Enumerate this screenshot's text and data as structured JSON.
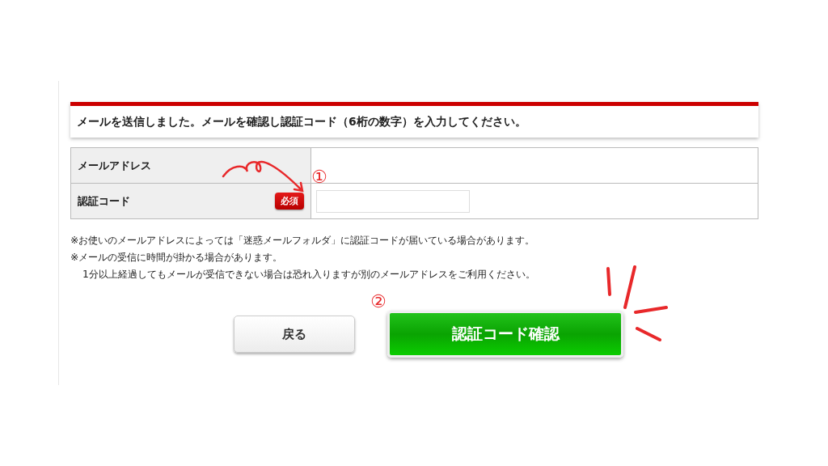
{
  "message": "メールを送信しました。メールを確認し認証コード（6桁の数字）を入力してください。",
  "form": {
    "rows": [
      {
        "label": "メールアドレス",
        "kind": "text"
      },
      {
        "label": "認証コード",
        "kind": "input",
        "badge": "必須"
      }
    ]
  },
  "notes": [
    {
      "text": "※お使いのメールアドレスによっては「迷惑メールフォルダ」に認証コードが届いている場合があります。",
      "kind": "note"
    },
    {
      "text": "※メールの受信に時間が掛かる場合があります。",
      "kind": "note"
    },
    {
      "text": "1分以上経過してもメールが受信できない場合は恐れ入りますが別のメールアドレスをご利用ください。",
      "kind": "continuation"
    }
  ],
  "buttons": [
    {
      "label": "戻る",
      "kind": "secondary"
    },
    {
      "label": "認証コード確認",
      "kind": "primary"
    }
  ],
  "annotations": [
    {
      "label": "①"
    },
    {
      "label": "②"
    }
  ]
}
